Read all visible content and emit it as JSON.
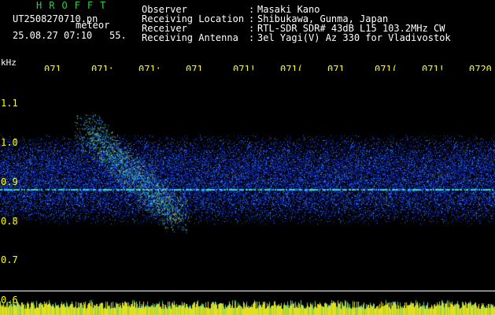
{
  "header": {
    "app_title": "HROFFT",
    "filename": "UT2508270710.pn",
    "filename_suffix": "meteor",
    "datetime": "25.08.27 07:10",
    "datetime_extra": "55.",
    "info": [
      {
        "key": "Observer",
        "value": "Masaki Kano"
      },
      {
        "key": "Receiving Location",
        "value": "Shibukawa, Gunma, Japan"
      },
      {
        "key": "Receiver",
        "value": "RTL-SDR SDR# 43dB L15 103.2MHz CW"
      },
      {
        "key": "Receiving Antenna",
        "value": "3el Yagi(V) Az 330 for Vladivostok"
      }
    ]
  },
  "axes": {
    "y_unit": "kHz",
    "time_ticks": [
      "071",
      "071:",
      "071:",
      "071.",
      "071!",
      "071(",
      "071",
      "071(",
      "071!",
      "0720"
    ],
    "freq_ticks": [
      "1.1",
      "1.0",
      "0.9",
      "0.8",
      "0.7",
      "0.6"
    ]
  },
  "colors": {
    "background": "#000000",
    "header_text": "#ffffff",
    "title_green": "#2ecc40",
    "tick_yellow": "#ffff00",
    "noise_low": "#0a1a8c",
    "noise_mid": "#1e5cff",
    "noise_high": "#30c8ff",
    "signal": "#ffff40"
  }
}
